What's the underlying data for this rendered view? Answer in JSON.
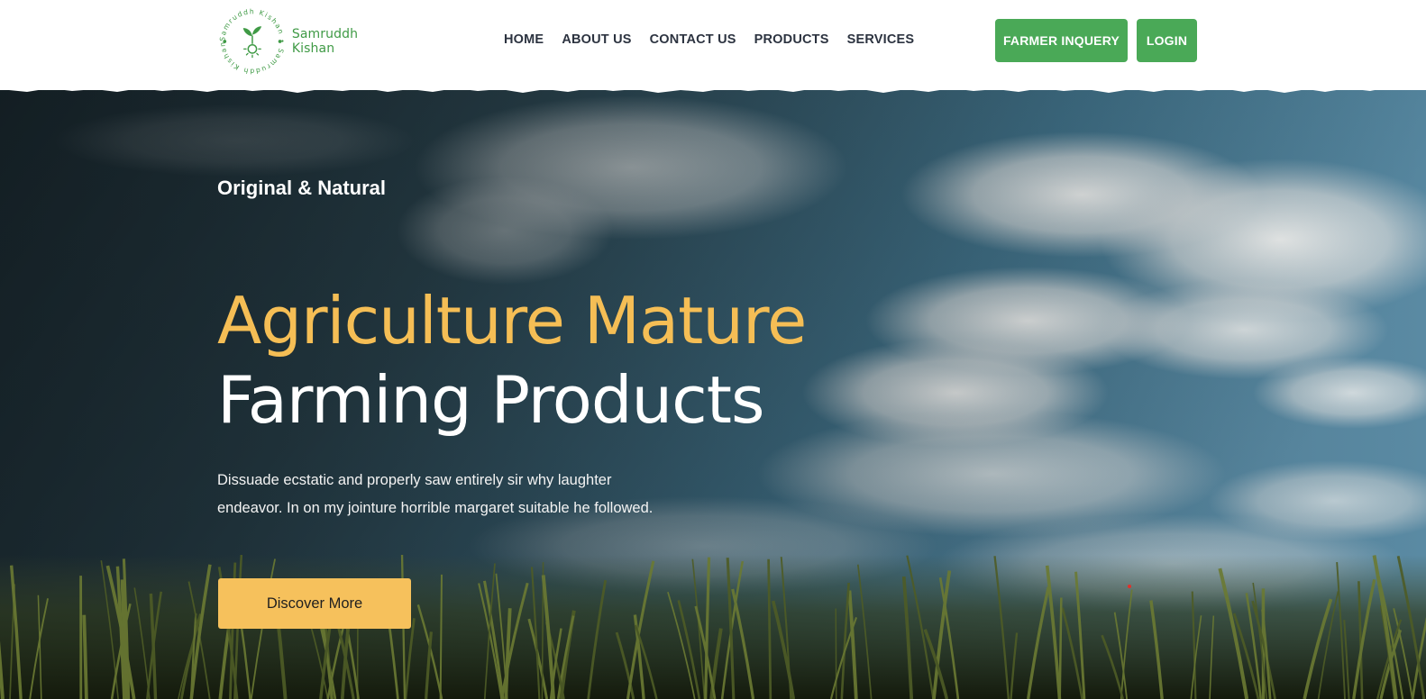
{
  "brand": {
    "name": "Samruddh Kishan",
    "ring_text": "Samruddh Kishan • Samruddh Kishan •",
    "color": "#3f9a45"
  },
  "nav": {
    "items": [
      {
        "label": "HOME"
      },
      {
        "label": "ABOUT US"
      },
      {
        "label": "CONTACT US"
      },
      {
        "label": "PRODUCTS"
      },
      {
        "label": "SERVICES"
      }
    ]
  },
  "header_actions": {
    "inquiry_label": "FARMER INQUERY",
    "login_label": "LOGIN",
    "button_color": "#4aa957"
  },
  "hero": {
    "eyebrow": "Original & Natural",
    "headline_line1": "Agriculture Mature",
    "headline_line2": "Farming Products",
    "description": "Dissuade ecstatic and properly saw entirely sir why laughter endeavor. In on my jointure horrible margaret suitable he followed.",
    "cta_label": "Discover More",
    "accent_color": "#f5be55"
  }
}
